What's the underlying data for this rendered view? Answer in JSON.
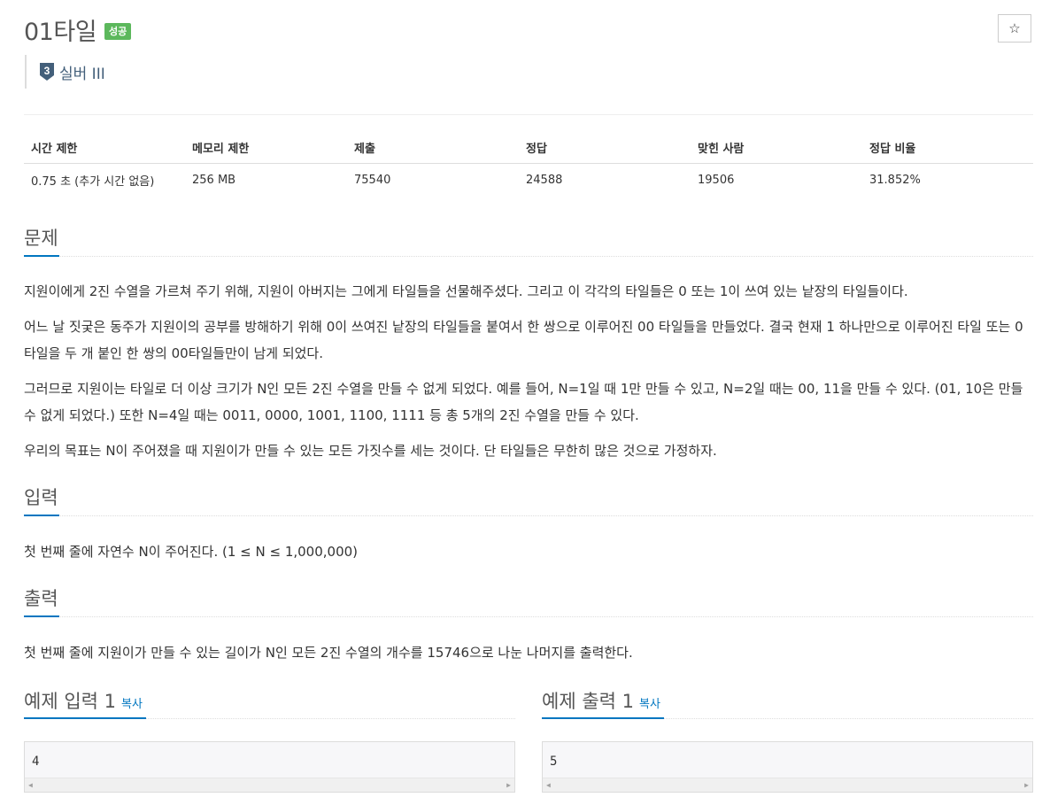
{
  "problem": {
    "title": "01타일",
    "status": "성공",
    "tier": "실버 III",
    "tier_number": "3",
    "star": "☆"
  },
  "info_table": {
    "headers": [
      "시간 제한",
      "메모리 제한",
      "제출",
      "정답",
      "맞힌 사람",
      "정답 비율"
    ],
    "values": [
      "0.75 초 (추가 시간 없음)",
      "256 MB",
      "75540",
      "24588",
      "19506",
      "31.852%"
    ]
  },
  "sections": {
    "problem_heading": "문제",
    "problem_paragraphs": [
      "지원이에게 2진 수열을 가르쳐 주기 위해, 지원이 아버지는 그에게 타일들을 선물해주셨다. 그리고 이 각각의 타일들은 0 또는 1이 쓰여 있는 낱장의 타일들이다.",
      "어느 날 짓궂은 동주가 지원이의 공부를 방해하기 위해 0이 쓰여진 낱장의 타일들을 붙여서 한 쌍으로 이루어진 00 타일들을 만들었다. 결국 현재 1 하나만으로 이루어진 타일 또는 0타일을 두 개 붙인 한 쌍의 00타일들만이 남게 되었다.",
      "그러므로 지원이는 타일로 더 이상 크기가 N인 모든 2진 수열을 만들 수 없게 되었다. 예를 들어, N=1일 때 1만 만들 수 있고, N=2일 때는 00, 11을 만들 수 있다. (01, 10은 만들 수 없게 되었다.) 또한 N=4일 때는 0011, 0000, 1001, 1100, 1111 등 총 5개의 2진 수열을 만들 수 있다.",
      "우리의 목표는 N이 주어졌을 때 지원이가 만들 수 있는 모든 가짓수를 세는 것이다. 단 타일들은 무한히 많은 것으로 가정하자."
    ],
    "input_heading": "입력",
    "input_text": "첫 번째 줄에 자연수 N이 주어진다. (1 ≤ N ≤ 1,000,000)",
    "output_heading": "출력",
    "output_text": "첫 번째 줄에 지원이가 만들 수 있는 길이가 N인 모든 2진 수열의 개수를 15746으로 나눈 나머지를 출력한다."
  },
  "samples": {
    "input_heading": "예제 입력 1",
    "output_heading": "예제 출력 1",
    "copy_label": "복사",
    "input_value": "4",
    "output_value": "5"
  },
  "colors": {
    "success": "#5cb85c",
    "accent": "#0076c0",
    "tier": "#435f7a"
  }
}
